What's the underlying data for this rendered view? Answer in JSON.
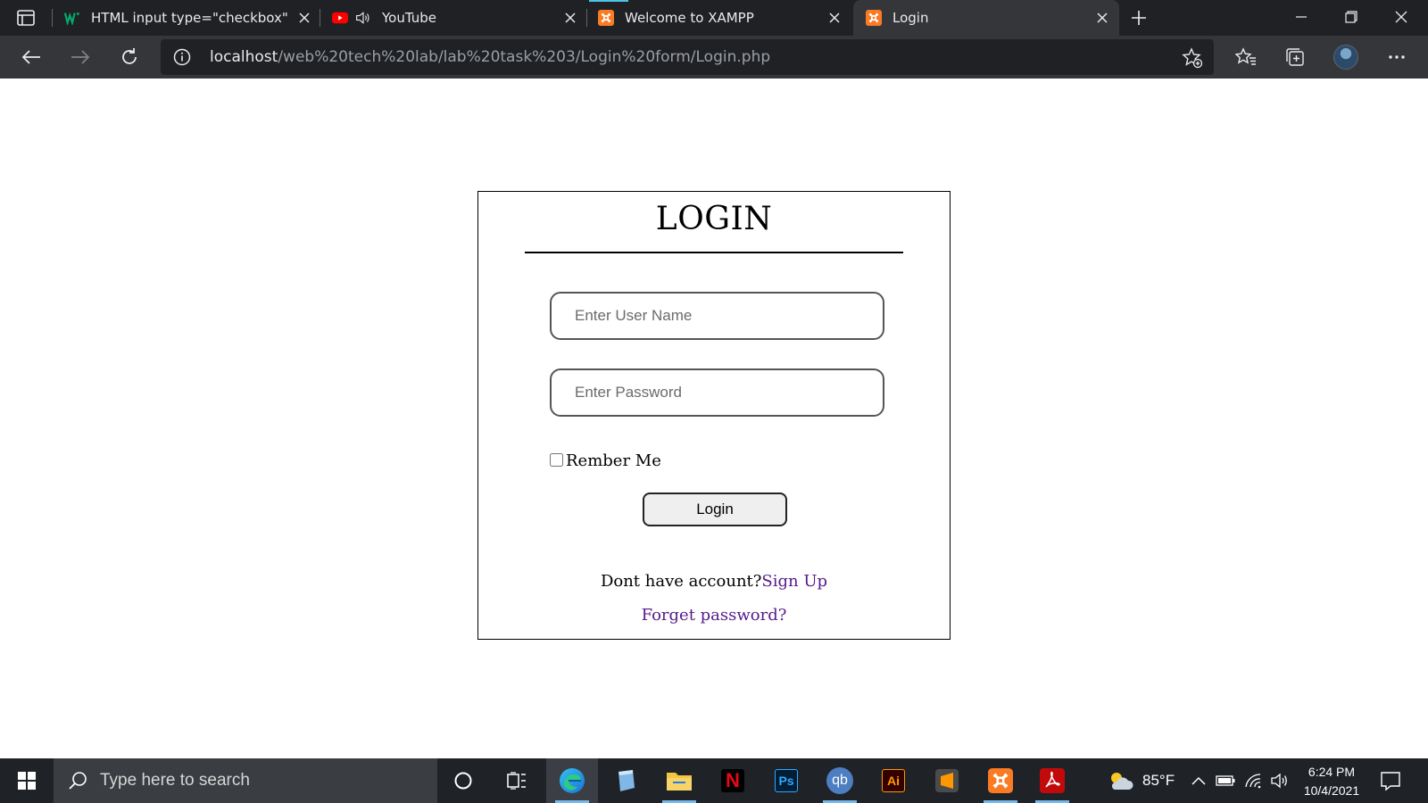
{
  "browser": {
    "tabs": [
      {
        "title": "HTML input type=\"checkbox\"",
        "favicon": "w3schools-icon",
        "active": false
      },
      {
        "title": "YouTube",
        "favicon": "youtube-icon",
        "audio": true,
        "active": false
      },
      {
        "title": "Welcome to XAMPP",
        "favicon": "xampp-icon",
        "active": false
      },
      {
        "title": "Login",
        "favicon": "xampp-icon",
        "active": true
      }
    ],
    "url_host": "localhost",
    "url_path": "/web%20tech%20lab/lab%20task%203/Login%20form/Login.php"
  },
  "login": {
    "title": "LOGIN",
    "username_placeholder": "Enter User Name",
    "password_placeholder": "Enter Password",
    "remember_label": "Rember Me",
    "remember_checked": false,
    "login_button": "Login",
    "no_account_text": "Dont have account?",
    "signup_link": "Sign Up",
    "forget_link": "Forget password?"
  },
  "taskbar": {
    "search_placeholder": "Type here to search",
    "apps": [
      "cortana-icon",
      "task-view-icon",
      "edge-icon",
      "notepad-icon",
      "file-explorer-icon",
      "netflix-icon",
      "photoshop-icon",
      "qbittorrent-icon",
      "illustrator-icon",
      "sublime-text-icon",
      "xampp-icon",
      "acrobat-icon"
    ],
    "weather": "85°F",
    "time": "6:24 PM",
    "date": "10/4/2021"
  },
  "colors": {
    "tab_strip": "#202124",
    "toolbar": "#35363a",
    "link": "#551a8b",
    "taskbar": "#1f2227"
  }
}
